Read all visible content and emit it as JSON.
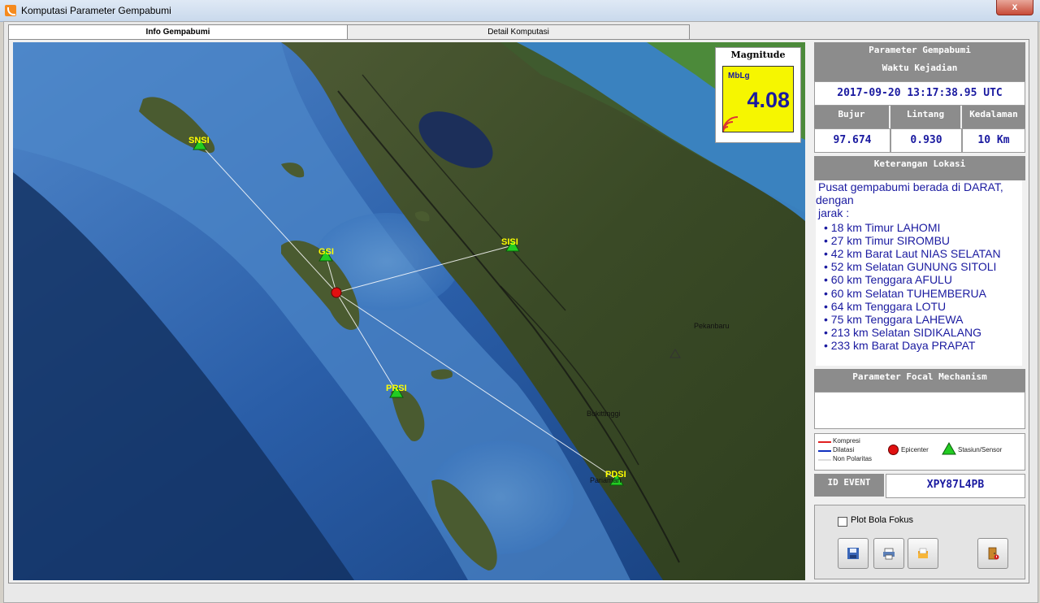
{
  "window": {
    "title": "Komputasi Parameter Gempabumi",
    "close_label": "x"
  },
  "tabs": [
    {
      "label": "Info Gempabumi"
    },
    {
      "label": "Detail Komputasi"
    }
  ],
  "magnitude": {
    "title": "Magnitude",
    "type": "MbLg",
    "value": "4.08"
  },
  "map": {
    "stations": [
      "SNSI",
      "GSI",
      "SISI",
      "PRSI",
      "PDSI"
    ],
    "place_labels": [
      "Pekanbaru",
      "Bukittinggi",
      "Pariaman"
    ]
  },
  "parameters": {
    "header": "Parameter Gempabumi",
    "time_label": "Waktu Kejadian",
    "time_value": "2017-09-20 13:17:38.95 UTC",
    "bujur_label": "Bujur",
    "lintang_label": "Lintang",
    "kedalaman_label": "Kedalaman",
    "bujur_value": "97.674",
    "lintang_value": "0.930",
    "kedalaman_value": "10 Km"
  },
  "location": {
    "header": "Keterangan Lokasi",
    "intro_line1": "Pusat gempabumi berada di DARAT,",
    "intro_line2": "dengan",
    "intro_line3": "jarak :",
    "items": [
      "18 km Timur LAHOMI",
      "27 km Timur SIROMBU",
      "42 km Barat Laut NIAS SELATAN",
      "52 km Selatan GUNUNG SITOLI",
      "60 km Tenggara AFULU",
      "60 km Selatan TUHEMBERUA",
      "64 km Tenggara LOTU",
      "75 km Tenggara LAHEWA",
      "213 km Selatan SIDIKALANG",
      "233 km Barat Daya PRAPAT"
    ]
  },
  "focal": {
    "header": "Parameter Focal Mechanism"
  },
  "legend": {
    "kompresi": "Kompresi",
    "dilatasi": "Dilatasi",
    "non_polaritas": "Non Polaritas",
    "epicenter": "Epicenter",
    "stasiun": "Stasiun/Sensor",
    "colors": {
      "kompresi": "#e02020",
      "dilatasi": "#1030c0",
      "non_polaritas": "#ffffff",
      "epicenter": "#e01010",
      "stasiun": "#22cc22"
    }
  },
  "event": {
    "label": "ID EVENT",
    "value": "XPY87L4PB"
  },
  "controls": {
    "checkbox_label": "Plot Bola Fokus",
    "buttons": [
      "save-icon",
      "print-icon",
      "open-folder-icon",
      "exit-door-icon"
    ]
  }
}
